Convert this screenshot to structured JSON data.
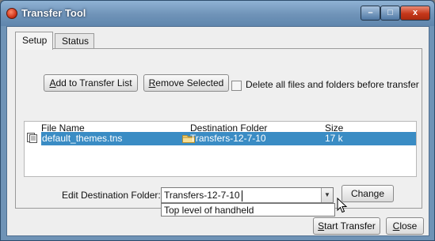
{
  "window": {
    "title": "Transfer Tool",
    "controls": {
      "minimize": "–",
      "maximize": "□",
      "close": "x"
    }
  },
  "tabs": [
    {
      "label": "Setup",
      "selected": true
    },
    {
      "label": "Status",
      "selected": false
    }
  ],
  "toolbar": {
    "add_button": {
      "mnemonic": "A",
      "rest": "dd to Transfer List"
    },
    "remove_button": {
      "mnemonic": "R",
      "rest": "emove Selected"
    },
    "delete_all_checkbox": {
      "label": "Delete all files and folders before transfer",
      "checked": false
    }
  },
  "file_table": {
    "columns": [
      "File Name",
      "Destination Folder",
      "Size"
    ],
    "rows": [
      {
        "file_name": "default_themes.tns",
        "destination": "Transfers-12-7-10",
        "size": "17 k",
        "selected": true
      }
    ]
  },
  "destination": {
    "label": "Edit Destination Folder:",
    "value": "Transfers-12-7-10",
    "options": [
      "Top level of handheld"
    ],
    "change_button": "Change"
  },
  "footer": {
    "start_button": {
      "mnemonic": "S",
      "rest": "tart Transfer"
    },
    "close_button": {
      "mnemonic": "C",
      "rest": "lose"
    }
  },
  "colors": {
    "selection": "#3a8cc4",
    "titlebar": "#6f93b6"
  }
}
